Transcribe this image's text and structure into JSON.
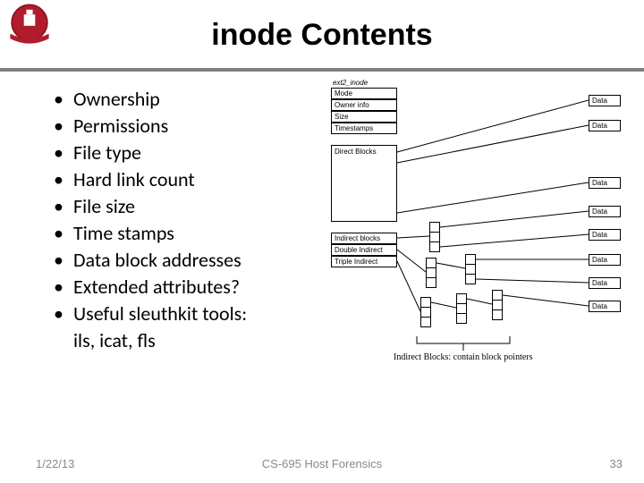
{
  "title": "inode Contents",
  "bullets": [
    "Ownership",
    "Permissions",
    "File type",
    "Hard link count",
    "File size",
    "Time stamps",
    "Data block addresses",
    "Extended attributes?",
    "Useful sleuthkit tools:"
  ],
  "bullets_sub": "ils, icat, fls",
  "diagram": {
    "header": "ext2_inode",
    "inode_rows": [
      "Mode",
      "Owner info",
      "Size",
      "Timestamps"
    ],
    "direct_label": "Direct Blocks",
    "indirect_rows": [
      "Indirect blocks",
      "Double Indirect",
      "Triple Indirect"
    ],
    "data_label": "Data",
    "caption": "Indirect Blocks: contain block pointers"
  },
  "footer": {
    "date": "1/22/13",
    "course": "CS-695 Host Forensics",
    "page": "33"
  }
}
